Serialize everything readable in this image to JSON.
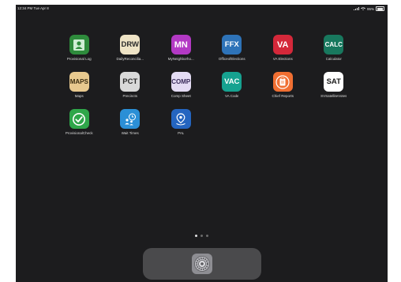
{
  "status": {
    "time": "12:34 PM  Tue Apr 8",
    "battery": "95%"
  },
  "apps": [
    {
      "name": "Provisional Log",
      "icon_text": "",
      "icon": "contact-card-icon",
      "bg": "#2e8b3c",
      "fg": "#ffffff"
    },
    {
      "name": "DailyReconcilia...",
      "icon_text": "DRW",
      "icon": "text",
      "bg": "#efe4c6",
      "fg": "#2a2a2a"
    },
    {
      "name": "MyNeighborho...",
      "icon_text": "MN",
      "icon": "text",
      "bg": "#b339c4",
      "fg": "#ffffff"
    },
    {
      "name": "OfficeofElections",
      "icon_text": "FFX",
      "icon": "text",
      "bg": "#2e73b8",
      "fg": "#ffffff"
    },
    {
      "name": "VA Elections",
      "icon_text": "VA",
      "icon": "text",
      "bg": "#d4283a",
      "fg": "#ffffff"
    },
    {
      "name": "Calculator",
      "icon_text": "CALC",
      "icon": "text",
      "bg": "#18785e",
      "fg": "#ffffff"
    },
    {
      "name": "Maps",
      "icon_text": "MAPS",
      "icon": "text",
      "bg": "#e8c98f",
      "fg": "#3a2c10"
    },
    {
      "name": "Precincts",
      "icon_text": "PCT",
      "icon": "text",
      "bg": "#d9d9d9",
      "fg": "#2a2a2a"
    },
    {
      "name": "Comp Sheet",
      "icon_text": "COMP",
      "icon": "text",
      "bg": "#e4dcf4",
      "fg": "#3a2c5a"
    },
    {
      "name": "VA Code",
      "icon_text": "VAC",
      "icon": "text",
      "bg": "#16a290",
      "fg": "#ffffff"
    },
    {
      "name": "Chief Reports",
      "icon_text": "",
      "icon": "clipboard-icon",
      "bg": "#f06f32",
      "fg": "#ffffff"
    },
    {
      "name": "SVSatelliteVotes",
      "icon_text": "SAT",
      "icon": "text",
      "bg": "#ffffff",
      "fg": "#1a1a1a"
    },
    {
      "name": "ProvisionalCheck",
      "icon_text": "",
      "icon": "checkmark-icon",
      "bg": "#2fa64a",
      "fg": "#ffffff"
    },
    {
      "name": "Wait Times",
      "icon_text": "",
      "icon": "people-clock-icon",
      "bg": "#2b8fd6",
      "fg": "#ffffff"
    },
    {
      "name": "PAL",
      "icon_text": "",
      "icon": "location-pin-icon",
      "bg": "#2465c0",
      "fg": "#ffffff"
    }
  ],
  "page_indicator": {
    "pages": 3,
    "current": 1
  },
  "dock": {
    "apps": [
      {
        "icon": "settings-gear-icon",
        "bg": "#8e8e93"
      }
    ]
  }
}
